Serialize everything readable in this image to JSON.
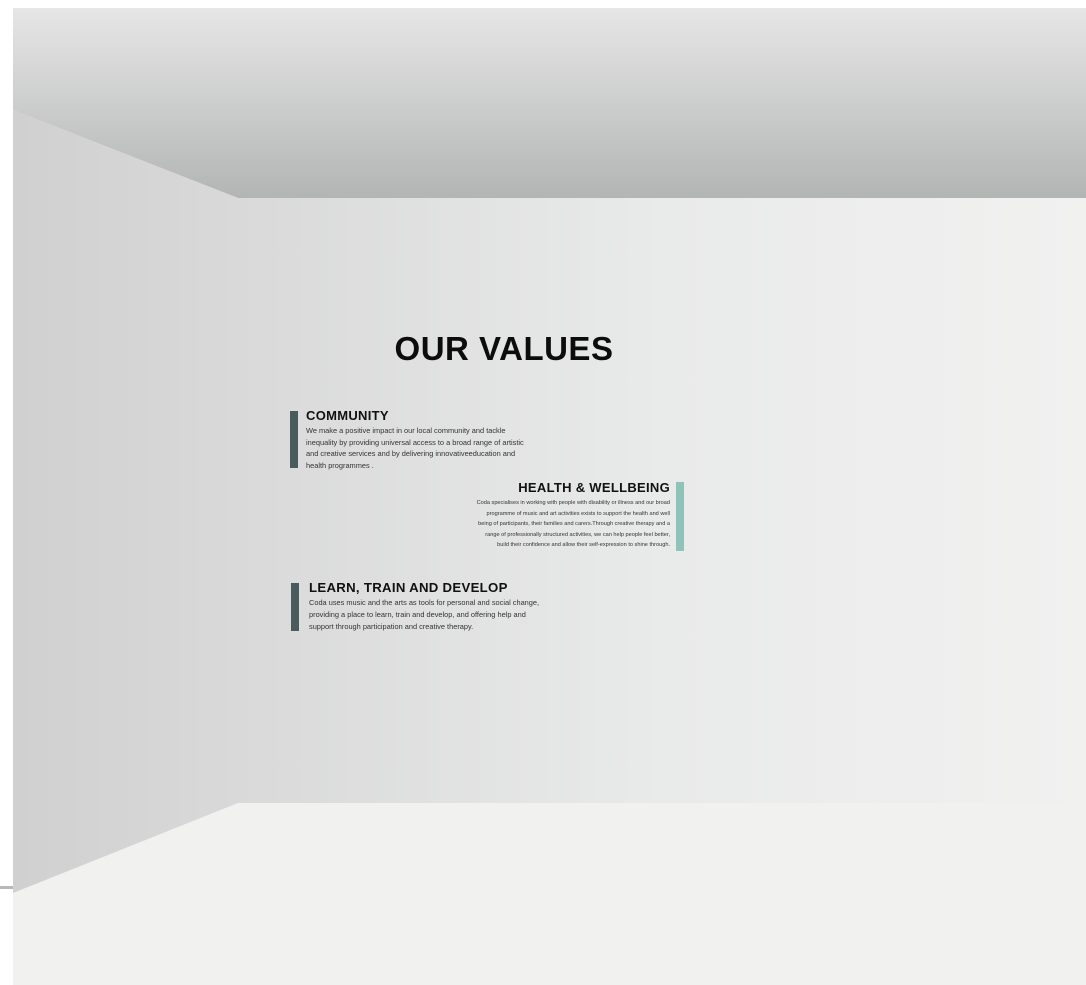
{
  "title": "OUR VALUES",
  "values": [
    {
      "heading": "COMMUNITY",
      "text": "We make a positive impact in our local community and tackle\ninequality by providing universal access to a broad range of artistic\nand creative services and by delivering innovativeeducation and\nhealth programmes .",
      "accent_color": "#4a5b5e"
    },
    {
      "heading": "HEALTH & WELLBEING",
      "text": "Coda specialises in working with people with disability or illness and our broad\nprogramme of music and art activities exists to support the health and well\nbeing of participants, their families and carers.Through creative therapy and a\nrange of professionally structured activities, we can help people feel better,\nbuild their confidence and allow their self-expression to shine through.",
      "accent_color": "#8fc2b8"
    },
    {
      "heading": "LEARN, TRAIN AND DEVELOP",
      "text": "Coda uses music and the arts as tools for personal and social change,\nproviding a place to learn, train and develop, and offering help and\nsupport through participation and creative therapy.",
      "accent_color": "#4a5b5e"
    }
  ]
}
